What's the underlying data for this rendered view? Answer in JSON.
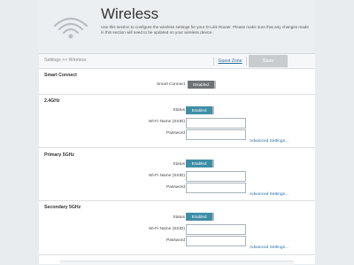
{
  "header": {
    "title": "Wireless",
    "description": "Use this section to configure the wireless settings for your D-Link Router. Please make sure that any changes made in this section will need to be updated on your wireless device."
  },
  "breadcrumb": "Settings >> Wireless",
  "toolbar": {
    "guest_zone": "Guest Zone",
    "save": "Save"
  },
  "smart_connect": {
    "title": "Smart Connect",
    "label": "Smart Connect",
    "state": "Disabled"
  },
  "band_24": {
    "title": "2.4GHz",
    "status_label": "Status",
    "status": "Enabled",
    "ssid_label": "Wi-Fi Name (SSID)",
    "ssid_value": "",
    "password_label": "Password",
    "password_value": "",
    "advanced": "Advanced Settings..."
  },
  "band_5_primary": {
    "title": "Primary 5GHz",
    "status_label": "Status",
    "status": "Enabled",
    "ssid_label": "Wi-Fi Name (SSID)",
    "ssid_value": "",
    "password_label": "Password",
    "password_value": "",
    "advanced": "Advanced Settings..."
  },
  "band_5_secondary": {
    "title": "Secondary 5GHz",
    "status_label": "Status",
    "status": "Enabled",
    "ssid_label": "Wi-Fi Name (SSID)",
    "ssid_value": "",
    "password_label": "Password",
    "password_value": "",
    "advanced": "Advanced Settings..."
  },
  "colors": {
    "accent": "#3f8ea6",
    "link": "#2a6fa8",
    "disabled": "#6f7376"
  },
  "icons": {
    "header": "wifi-icon"
  }
}
